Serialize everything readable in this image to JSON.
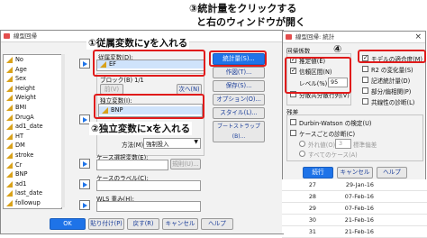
{
  "annotations": {
    "step3_line1": "③統計量をクリックする",
    "step3_line2": "と右のウィンドウが開く",
    "step1": "①従属変数にyを入れる",
    "step2": "②独立変数にxを入れる",
    "step4": "④"
  },
  "main_dialog": {
    "title": "線型回帰",
    "variables": [
      "No",
      "Age",
      "Sex",
      "Height",
      "Weight",
      "BMI",
      "DrugA",
      "ad1_date",
      "HT",
      "DM",
      "stroke",
      "Cr",
      "BNP",
      "ad1",
      "last_date",
      "followup"
    ],
    "dependent_label": "従属変数(D):",
    "dependent_value": "EF",
    "block_label": "ブロック(B) 1/1",
    "prev_button": "前(V)",
    "next_button": "次へ(N)",
    "independent_label": "独立変数(I):",
    "independent_value": "BNP",
    "method_label": "方法(M):",
    "method_value": "強制投入",
    "case_select_label": "ケース選択変数(E):",
    "rule_button": "規則(U)...",
    "case_label_label": "ケースのラベル(C):",
    "wls_label": "WLS 重み(H):",
    "buttons": {
      "statistics": "統計量(S)...",
      "plots": "作図(T)...",
      "save": "保存(S)...",
      "options": "オプション(O)...",
      "style": "スタイル(L)...",
      "bootstrap": "ブートストラップ(B)..."
    },
    "footer": {
      "ok": "OK",
      "paste": "貼り付け(P)",
      "reset": "戻す(R)",
      "cancel": "キャンセル",
      "help": "ヘルプ"
    }
  },
  "stats_dialog": {
    "title": "線型回帰: 統計",
    "regression_coef_label": "回帰係数",
    "estimates": "推定値(E)",
    "confidence": "信頼区間(N)",
    "level_label": "レベル(%):",
    "level_value": "95",
    "covariance": "分散共分散行列(V)",
    "model_fit": "モデルの適合度(M)",
    "r2_change": "R2 の変化量(S)",
    "descriptives": "記述統計量(D)",
    "part_partial": "部分/偏相関(P)",
    "collinearity": "共線性の診断(L)",
    "residuals_label": "残差",
    "durbin_watson": "Durbin-Watson の検定(U)",
    "casewise": "ケースごとの診断(C)",
    "outliers": "外れ値(O):",
    "outliers_value": "3",
    "sd_label": "標準偏差",
    "all_cases": "すべてのケース(A)",
    "continue": "続行",
    "cancel": "キャンセル",
    "help": "ヘルプ"
  },
  "background_data": [
    {
      "col1": "27",
      "col2": "29-Jan-16"
    },
    {
      "col1": "28",
      "col2": "07-Feb-16"
    },
    {
      "col1": "29",
      "col2": "07-Feb-16"
    },
    {
      "col1": "30",
      "col2": "21-Feb-16"
    },
    {
      "col1": "31",
      "col2": "21-Feb-16"
    }
  ]
}
